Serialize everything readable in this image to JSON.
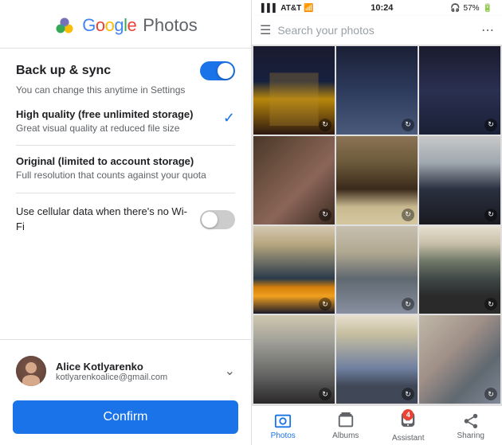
{
  "left": {
    "logo": {
      "google": "Google",
      "photos": "Photos"
    },
    "backup": {
      "title": "Back up & sync",
      "subtitle": "You can change this anytime in Settings",
      "toggle_on": true
    },
    "high_quality": {
      "title": "High quality (free unlimited storage)",
      "description": "Great visual quality at reduced file size",
      "selected": true
    },
    "original": {
      "title": "Original (limited to account storage)",
      "description": "Full resolution that counts against your quota"
    },
    "cellular": {
      "text": "Use cellular data when there's no Wi-Fi",
      "toggle_on": false
    },
    "account": {
      "name": "Alice Kotlyarenko",
      "email": "kotlyarenkoalice@gmail.com"
    },
    "confirm_button": "Confirm"
  },
  "right": {
    "status_bar": {
      "signal": "AT&T",
      "time": "10:24",
      "battery": "57%"
    },
    "search_placeholder": "Search your photos",
    "photos": [
      {
        "id": 1,
        "class": "photo-1"
      },
      {
        "id": 2,
        "class": "photo-2"
      },
      {
        "id": 3,
        "class": "photo-3"
      },
      {
        "id": 4,
        "class": "photo-4"
      },
      {
        "id": 5,
        "class": "photo-5"
      },
      {
        "id": 6,
        "class": "photo-6"
      },
      {
        "id": 7,
        "class": "photo-7"
      },
      {
        "id": 8,
        "class": "photo-8"
      },
      {
        "id": 9,
        "class": "photo-9"
      },
      {
        "id": 10,
        "class": "photo-10"
      },
      {
        "id": 11,
        "class": "photo-11"
      },
      {
        "id": 12,
        "class": "photo-12"
      }
    ],
    "nav": {
      "items": [
        {
          "label": "Photos",
          "active": true
        },
        {
          "label": "Albums",
          "active": false
        },
        {
          "label": "Assistant",
          "active": false,
          "badge": "4"
        },
        {
          "label": "Sharing",
          "active": false
        }
      ]
    }
  }
}
